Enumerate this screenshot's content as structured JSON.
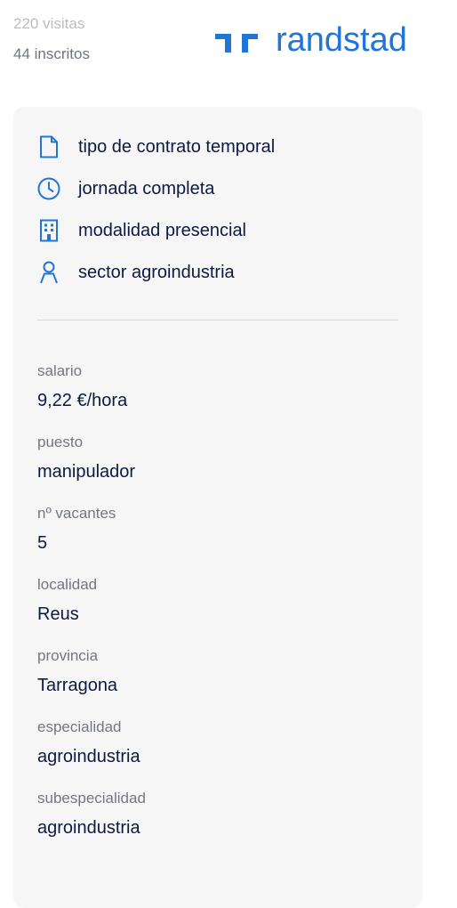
{
  "stats": {
    "visits": "220 visitas",
    "inscritos": "44 inscritos"
  },
  "logo": {
    "text": "randstad",
    "color": "#2175d9"
  },
  "features": [
    {
      "icon": "document-icon",
      "label": "tipo de contrato temporal"
    },
    {
      "icon": "clock-icon",
      "label": "jornada completa"
    },
    {
      "icon": "building-icon",
      "label": "modalidad presencial"
    },
    {
      "icon": "person-icon",
      "label": "sector agroindustria"
    }
  ],
  "details": [
    {
      "key": "salario",
      "value": "9,22 €/hora"
    },
    {
      "key": "puesto",
      "value": "manipulador"
    },
    {
      "key": "nº vacantes",
      "value": "5"
    },
    {
      "key": "localidad",
      "value": "Reus"
    },
    {
      "key": "provincia",
      "value": "Tarragona"
    },
    {
      "key": "especialidad",
      "value": "agroindustria"
    },
    {
      "key": "subespecialidad",
      "value": "agroindustria"
    }
  ],
  "colors": {
    "accent": "#2175d9",
    "text": "#0f1941",
    "muted": "#737782",
    "card_bg": "#f6f6f6"
  }
}
